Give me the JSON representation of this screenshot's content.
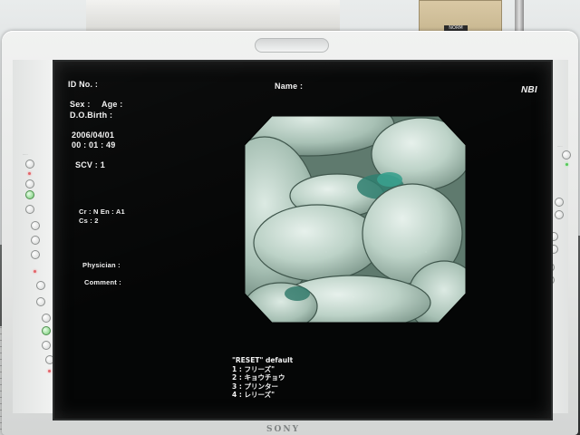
{
  "overlay": {
    "id_no": "ID No. :",
    "name": "Name :",
    "mode": "NBI",
    "sex": "Sex :",
    "age": "Age :",
    "dob": "D.O.Birth :",
    "date": "2006/04/01",
    "time": "00 : 01 : 49",
    "scv": "SCV : 1",
    "cf_line": "Cr : N  En : A1",
    "cs_line": "Cs : 2",
    "physician": "Physician :",
    "comment": "Comment :"
  },
  "menu": {
    "title": "\"RESET\" default",
    "items": [
      "1 : フリーズ\"",
      "2 : キョウチョウ",
      "3 : プリンター",
      "4 : レリーズ\""
    ]
  },
  "brand": "SONY",
  "box_label": "NORM",
  "colors": {
    "screen": "#050606",
    "osd_text": "#f2f2f2",
    "bezel": "#e6e7e6",
    "led_red": "#e2656a",
    "led_green": "#56c65a",
    "tissue": "#b9d0c5"
  }
}
